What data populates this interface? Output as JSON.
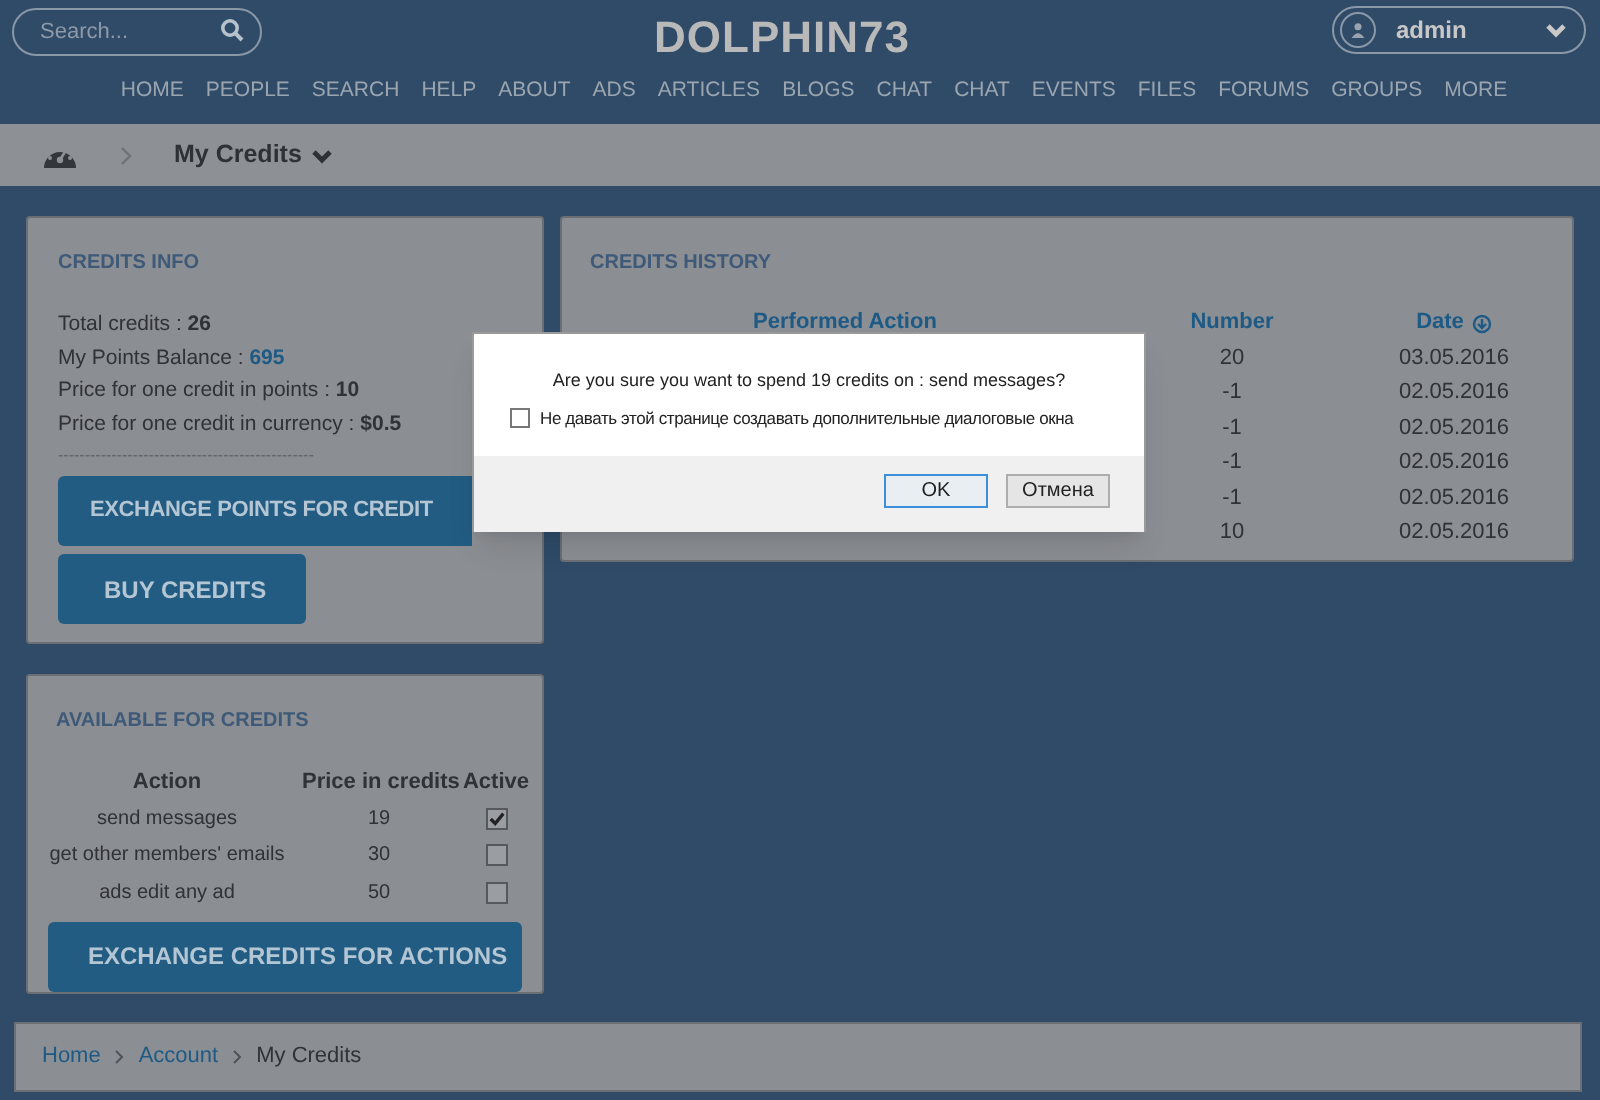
{
  "header": {
    "search_placeholder": "Search...",
    "logo": "DOLPHIN73",
    "user": "admin"
  },
  "nav": [
    "HOME",
    "PEOPLE",
    "SEARCH",
    "HELP",
    "ABOUT",
    "ADS",
    "ARTICLES",
    "BLOGS",
    "CHAT",
    "CHAT",
    "EVENTS",
    "FILES",
    "FORUMS",
    "GROUPS",
    "MORE"
  ],
  "page_menu": {
    "title": "My Credits"
  },
  "credits_info": {
    "heading": "CREDITS INFO",
    "stats": [
      {
        "label": "Total credits : ",
        "value": "26",
        "kind": "plain"
      },
      {
        "label": "My Points Balance : ",
        "value": "695",
        "kind": "link"
      },
      {
        "label": "Price for one credit in points : ",
        "value": "10",
        "kind": "plain"
      },
      {
        "label": "Price for one credit in currency : ",
        "value": "$0.5",
        "kind": "plain"
      }
    ],
    "separator": "------------------------------------------------",
    "buttons": [
      "EXCHANGE POINTS FOR CREDIT",
      "BUY CREDITS"
    ]
  },
  "credits_history": {
    "heading": "CREDITS HISTORY",
    "columns": [
      "Performed Action",
      "Number",
      "Date"
    ],
    "rows": [
      {
        "number": "20",
        "date": "03.05.2016"
      },
      {
        "number": "-1",
        "date": "02.05.2016"
      },
      {
        "number": "-1",
        "date": "02.05.2016"
      },
      {
        "number": "-1",
        "date": "02.05.2016"
      },
      {
        "number": "-1",
        "date": "02.05.2016"
      },
      {
        "number": "10",
        "date": "02.05.2016"
      }
    ]
  },
  "available": {
    "heading": "AVAILABLE FOR CREDITS",
    "columns": [
      "Action",
      "Price in credits",
      "Active"
    ],
    "rows": [
      {
        "action": "send messages",
        "price": "19",
        "active": true
      },
      {
        "action": "get other members' emails",
        "price": "30",
        "active": false
      },
      {
        "action": "ads edit any ad",
        "price": "50",
        "active": false
      }
    ],
    "button": "EXCHANGE CREDITS FOR ACTIONS"
  },
  "breadcrumb": [
    {
      "label": "Home",
      "kind": "link"
    },
    {
      "label": "Account",
      "kind": "link"
    },
    {
      "label": "My Credits",
      "kind": "current"
    }
  ],
  "dialog": {
    "message": "Are you sure you want to spend 19 credits on : send messages?",
    "checkbox_label": "Не давать этой странице создавать дополнительные диалоговые окна",
    "checked": false,
    "buttons": [
      {
        "label": "OK",
        "selected": true
      },
      {
        "label": "Отмена",
        "selected": false
      }
    ]
  }
}
